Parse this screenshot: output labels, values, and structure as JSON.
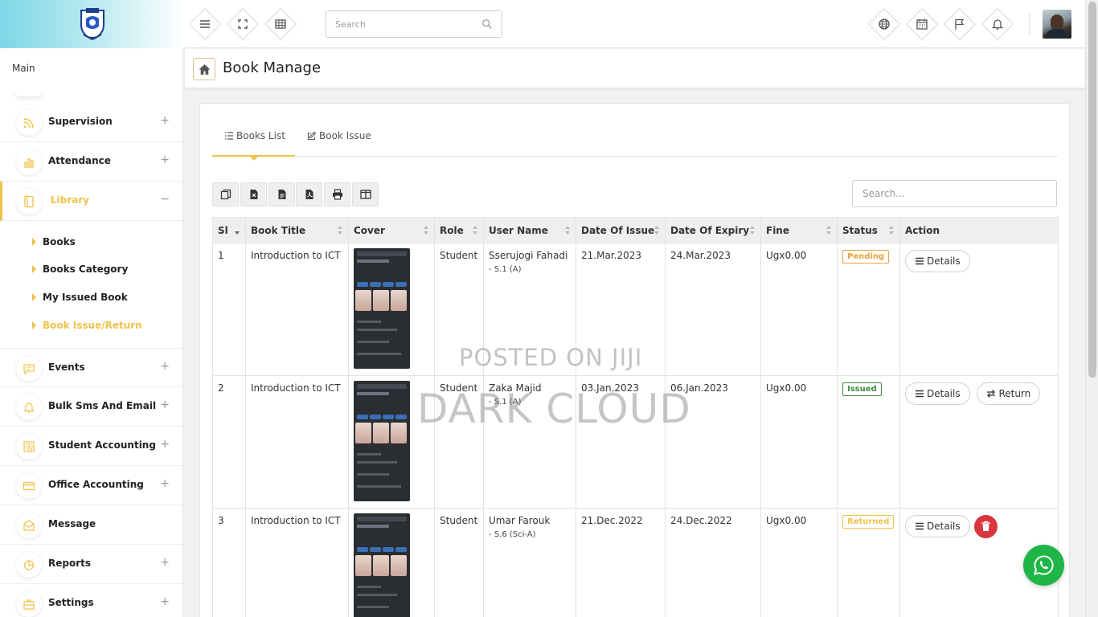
{
  "header": {
    "search_placeholder": "Search"
  },
  "sidebar": {
    "section_label": "Main",
    "items": [
      {
        "label": "Supervision",
        "expander": "+"
      },
      {
        "label": "Attendance",
        "expander": "+"
      },
      {
        "label": "Library",
        "expander": "−"
      },
      {
        "label": "Events",
        "expander": "+"
      },
      {
        "label": "Bulk Sms And Email",
        "expander": "+"
      },
      {
        "label": "Student Accounting",
        "expander": "+"
      },
      {
        "label": "Office Accounting",
        "expander": "+"
      },
      {
        "label": "Message",
        "expander": ""
      },
      {
        "label": "Reports",
        "expander": "+"
      },
      {
        "label": "Settings",
        "expander": "+"
      }
    ],
    "library_submenu": [
      "Books",
      "Books Category",
      "My Issued Book",
      "Book Issue/Return"
    ]
  },
  "page": {
    "title": "Book Manage"
  },
  "tabs": {
    "books_list": "Books List",
    "book_issue": "Book Issue"
  },
  "table_search_placeholder": "Search...",
  "table": {
    "headers": [
      "Sl",
      "Book Title",
      "Cover",
      "Role",
      "User Name",
      "Date Of Issue",
      "Date Of Expiry",
      "Fine",
      "Status",
      "Action"
    ],
    "rows": [
      {
        "sl": "1",
        "title": "Introduction to ICT",
        "role": "Student",
        "user": "Sserujogi Fahadi",
        "class": "- S.1 (A)",
        "issue": "21.Mar.2023",
        "expiry": "24.Mar.2023",
        "fine": "Ugx0.00",
        "status": "Pending",
        "details": "Details"
      },
      {
        "sl": "2",
        "title": "Introduction to ICT",
        "role": "Student",
        "user": "Zaka Majid",
        "class": "- S.1 (A)",
        "issue": "03.Jan.2023",
        "expiry": "06.Jan.2023",
        "fine": "Ugx0.00",
        "status": "Issued",
        "details": "Details",
        "return": "Return"
      },
      {
        "sl": "3",
        "title": "Introduction to ICT",
        "role": "Student",
        "user": "Umar Farouk",
        "class": "- S.6 (Sci-A)",
        "issue": "21.Dec.2022",
        "expiry": "24.Dec.2022",
        "fine": "Ugx0.00",
        "status": "Returned",
        "details": "Details"
      }
    ]
  },
  "watermark": {
    "line1": "POSTED ON JIJI",
    "line2": "DARK CLOUD"
  },
  "colors": {
    "accent": "#f0c24a",
    "pending": "#e8a33d",
    "issued": "#3c8c3c",
    "delete": "#d9363e",
    "whatsapp": "#1fb647"
  }
}
